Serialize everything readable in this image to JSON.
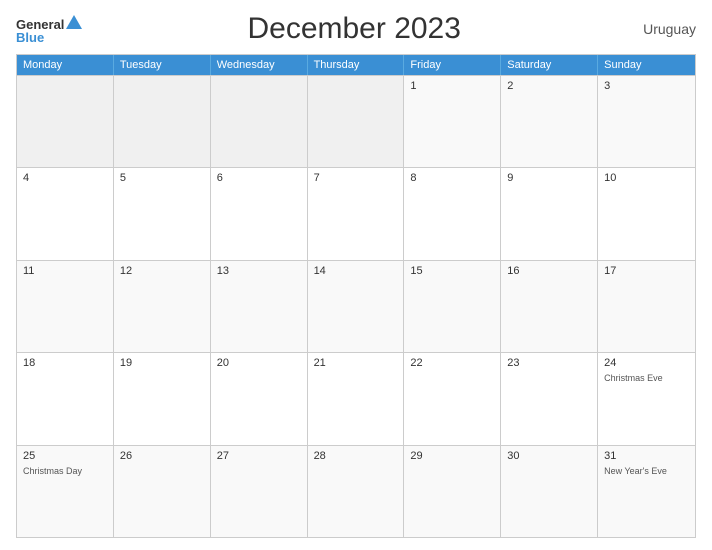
{
  "header": {
    "title": "December 2023",
    "country": "Uruguay",
    "logo_general": "General",
    "logo_blue": "Blue"
  },
  "dayHeaders": [
    "Monday",
    "Tuesday",
    "Wednesday",
    "Thursday",
    "Friday",
    "Saturday",
    "Sunday"
  ],
  "weeks": [
    [
      {
        "day": "",
        "empty": true
      },
      {
        "day": "",
        "empty": true
      },
      {
        "day": "",
        "empty": true
      },
      {
        "day": "",
        "empty": true
      },
      {
        "day": "1",
        "empty": false,
        "event": ""
      },
      {
        "day": "2",
        "empty": false,
        "event": ""
      },
      {
        "day": "3",
        "empty": false,
        "event": ""
      }
    ],
    [
      {
        "day": "4",
        "empty": false,
        "event": ""
      },
      {
        "day": "5",
        "empty": false,
        "event": ""
      },
      {
        "day": "6",
        "empty": false,
        "event": ""
      },
      {
        "day": "7",
        "empty": false,
        "event": ""
      },
      {
        "day": "8",
        "empty": false,
        "event": ""
      },
      {
        "day": "9",
        "empty": false,
        "event": ""
      },
      {
        "day": "10",
        "empty": false,
        "event": ""
      }
    ],
    [
      {
        "day": "11",
        "empty": false,
        "event": ""
      },
      {
        "day": "12",
        "empty": false,
        "event": ""
      },
      {
        "day": "13",
        "empty": false,
        "event": ""
      },
      {
        "day": "14",
        "empty": false,
        "event": ""
      },
      {
        "day": "15",
        "empty": false,
        "event": ""
      },
      {
        "day": "16",
        "empty": false,
        "event": ""
      },
      {
        "day": "17",
        "empty": false,
        "event": ""
      }
    ],
    [
      {
        "day": "18",
        "empty": false,
        "event": ""
      },
      {
        "day": "19",
        "empty": false,
        "event": ""
      },
      {
        "day": "20",
        "empty": false,
        "event": ""
      },
      {
        "day": "21",
        "empty": false,
        "event": ""
      },
      {
        "day": "22",
        "empty": false,
        "event": ""
      },
      {
        "day": "23",
        "empty": false,
        "event": ""
      },
      {
        "day": "24",
        "empty": false,
        "event": "Christmas Eve"
      }
    ],
    [
      {
        "day": "25",
        "empty": false,
        "event": "Christmas Day"
      },
      {
        "day": "26",
        "empty": false,
        "event": ""
      },
      {
        "day": "27",
        "empty": false,
        "event": ""
      },
      {
        "day": "28",
        "empty": false,
        "event": ""
      },
      {
        "day": "29",
        "empty": false,
        "event": ""
      },
      {
        "day": "30",
        "empty": false,
        "event": ""
      },
      {
        "day": "31",
        "empty": false,
        "event": "New Year's Eve"
      }
    ]
  ]
}
